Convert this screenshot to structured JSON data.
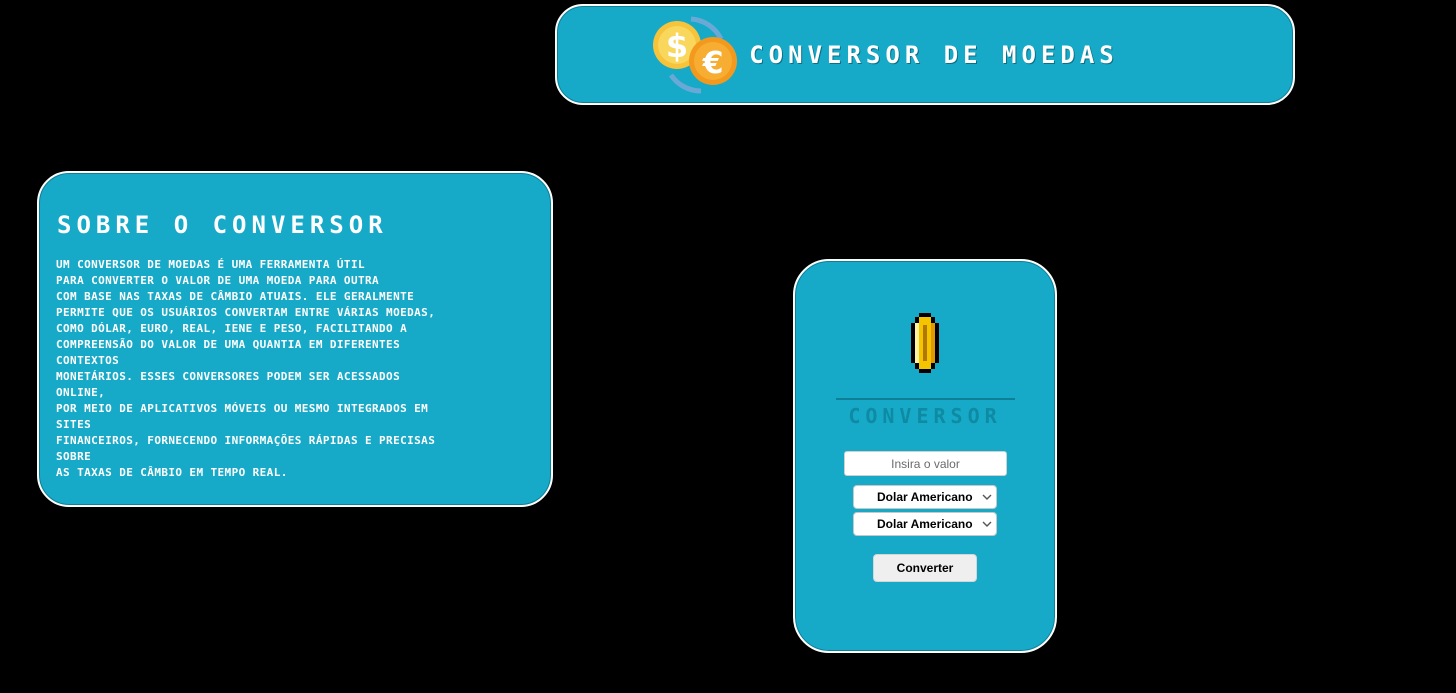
{
  "header": {
    "title": "Conversor de Moedas",
    "logo_icon": "currency-exchange-icon"
  },
  "about": {
    "title": "Sobre o Conversor",
    "text": "Um conversor de moedas é uma ferramenta útil\npara converter o valor de uma moeda para outra\ncom base nas taxas de câmbio atuais. Ele geralmente\npermite que os usuários convertam entre várias moedas,\ncomo dólar, euro, real, iene e peso, facilitando a\ncompreensão do valor de uma quantia em diferentes\ncontextos\nmonetários. Esses conversores podem ser acessados\nonline,\npor meio de aplicativos móveis ou mesmo integrados em\nsites\nfinanceiros, fornecendo informações rápidas e precisas\nsobre\nas taxas de câmbio em tempo real."
  },
  "converter": {
    "coin_icon": "coin-icon",
    "title": "Conversor",
    "input": {
      "placeholder": "Insira o valor",
      "value": ""
    },
    "from_currency": "Dolar Americano",
    "to_currency": "Dolar Americano",
    "button_label": "Converter"
  },
  "colors": {
    "background": "#000000",
    "panel": "#16aac8",
    "panel_border": "#ffffff",
    "text": "#ffffff",
    "converter_title": "#0f8aa3"
  }
}
